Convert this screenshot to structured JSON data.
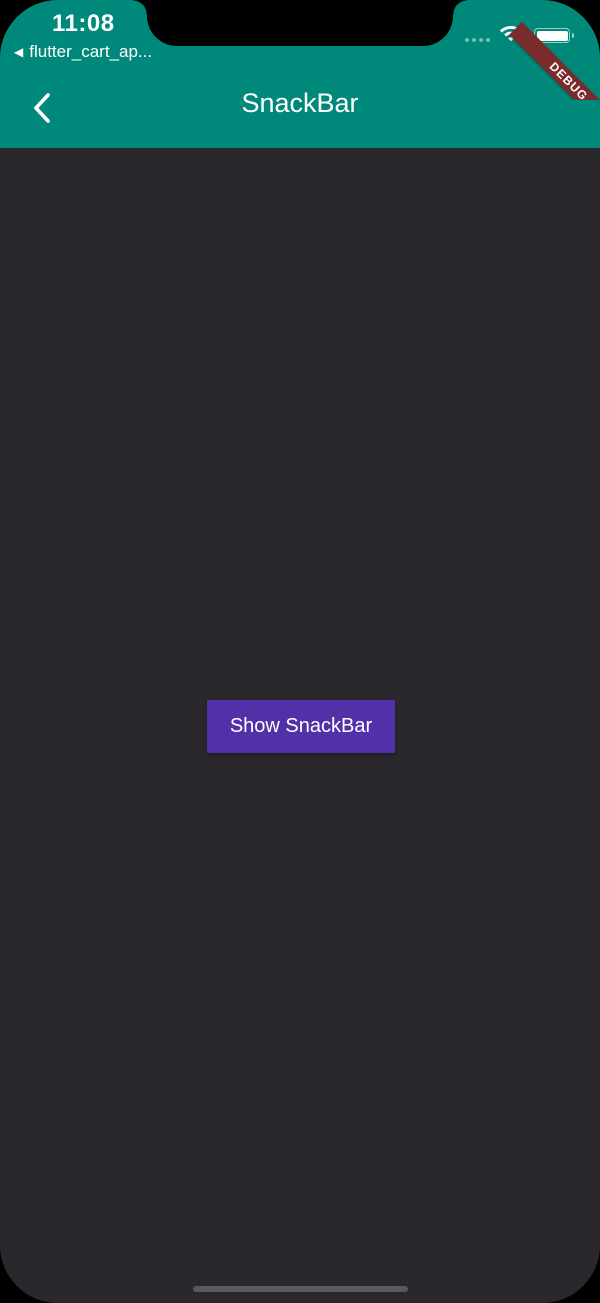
{
  "status_bar": {
    "time": "11:08",
    "back_app_label": "flutter_cart_ap...",
    "back_arrow_glyph": "◀",
    "signal_icon": "signal-dots-icon",
    "wifi_icon": "wifi-icon",
    "battery_icon": "battery-icon",
    "battery_level": 1.0
  },
  "debug_banner": {
    "label": "DEBUG",
    "color": "#7a2b2b"
  },
  "app_bar": {
    "title": "SnackBar",
    "back_icon": "chevron-left-icon",
    "background_color": "#00897b"
  },
  "main": {
    "background_color": "#2a282c",
    "show_snackbar_button": {
      "label": "Show SnackBar",
      "color": "#5230a8"
    }
  }
}
